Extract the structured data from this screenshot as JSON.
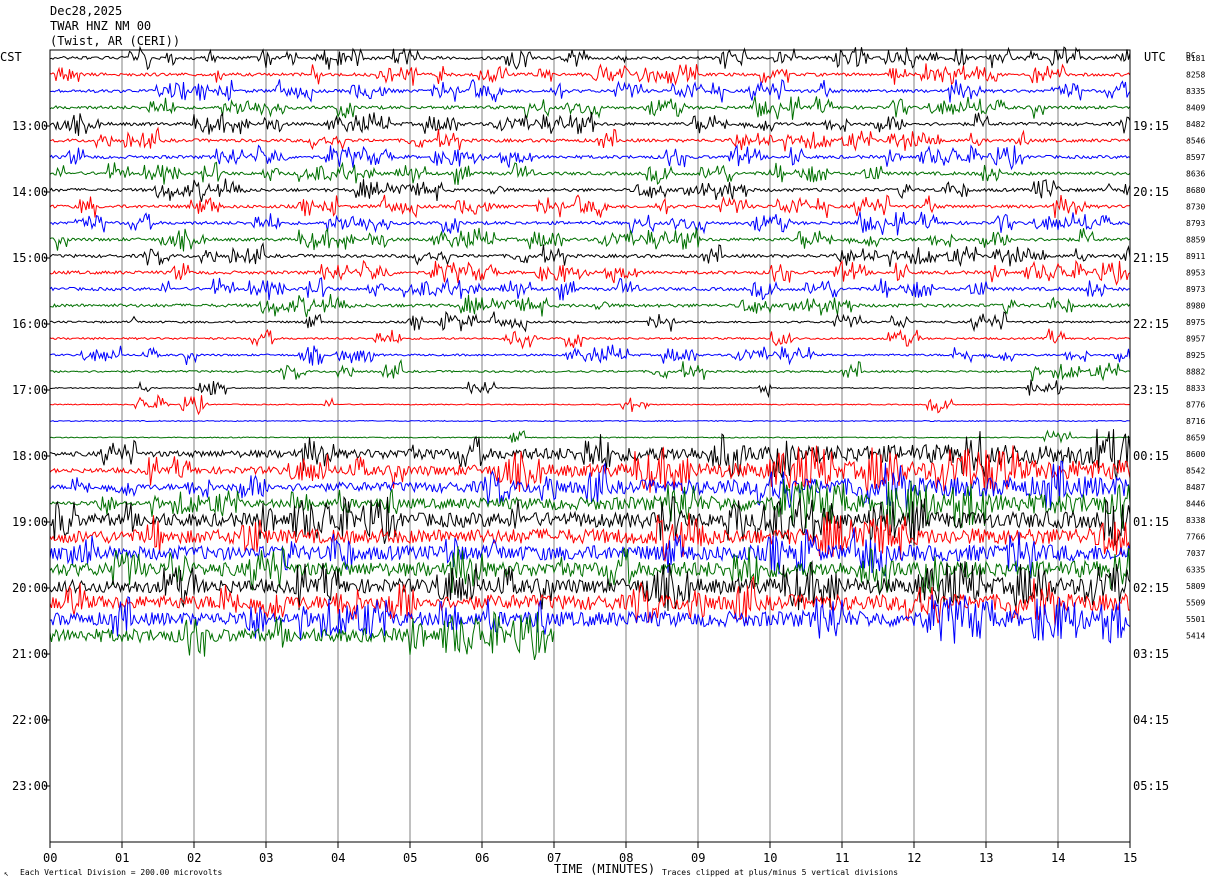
{
  "header": {
    "date": "Dec28,2025",
    "station": "TWAR HNZ NM 00",
    "location": "(Twist, AR (CERI))"
  },
  "chart_data": {
    "type": "line",
    "subtype": "helicorder",
    "left_axis_label": "CST",
    "right_axis_label": "UTC",
    "dc_label": "DC",
    "xlabel": "TIME (MINUTES)",
    "x_ticks": [
      "00",
      "01",
      "02",
      "03",
      "04",
      "05",
      "06",
      "07",
      "08",
      "09",
      "10",
      "11",
      "12",
      "13",
      "14",
      "15"
    ],
    "xlim": [
      0,
      15
    ],
    "left_hour_labels": [
      "13:00",
      "14:00",
      "15:00",
      "16:00",
      "17:00",
      "18:00",
      "19:00",
      "20:00",
      "21:00",
      "22:00",
      "23:00"
    ],
    "right_hour_labels": [
      "19:15",
      "20:15",
      "21:15",
      "22:15",
      "23:15",
      "00:15",
      "01:15",
      "02:15",
      "03:15",
      "04:15",
      "05:15"
    ],
    "trace_colors": [
      "#000000",
      "#ff0000",
      "#0000ff",
      "#007000"
    ],
    "dc_offsets": [
      8181,
      8258,
      8335,
      8409,
      8482,
      8546,
      8597,
      8636,
      8680,
      8730,
      8793,
      8859,
      8911,
      8953,
      8973,
      8980,
      8975,
      8957,
      8925,
      8882,
      8833,
      8776,
      8716,
      8659,
      8600,
      8542,
      8487,
      8446,
      8338,
      7766,
      7037,
      6335,
      5809,
      5509,
      5501,
      5414
    ],
    "last_trace_end_minute": 7,
    "footer_left": "Each Vertical Division =  200.00 microvolts",
    "footer_right": "Traces clipped at plus/minus 5 vertical divisions",
    "grid": true
  }
}
